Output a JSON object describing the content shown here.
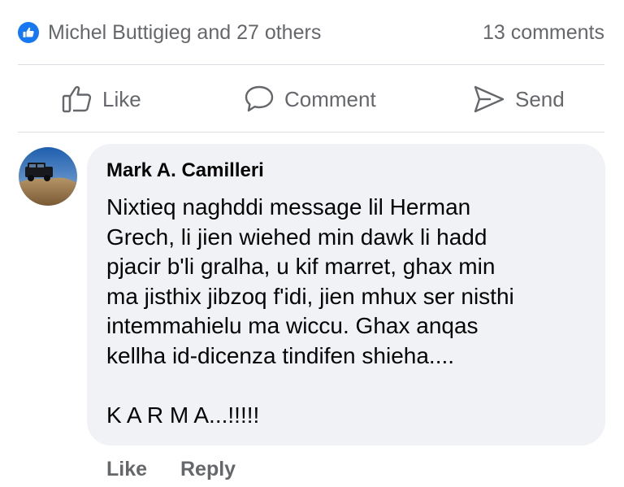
{
  "post_summary": {
    "reactors": "Michel Buttigieg and 27 others",
    "comment_count": "13 comments",
    "reaction_icon": "thumbs-up-icon",
    "reaction_color": "#1877f2"
  },
  "actions": [
    {
      "label": "Like",
      "icon": "thumbs-up-outline-icon"
    },
    {
      "label": "Comment",
      "icon": "speech-bubble-icon"
    },
    {
      "label": "Send",
      "icon": "paper-plane-icon"
    }
  ],
  "comment": {
    "author": "Mark A. Camilleri",
    "text": "Nixtieq naghddi message lil Herman\nGrech, li jien wiehed min dawk li hadd\npjacir b'li gralha, u kif marret, ghax min\nma jisthix jibzoq f'idi, jien mhux ser nisthi\nintemmahielu ma wiccu. Ghax anqas\nkellha id-dicenza tindifen shieha....\n\nK A R M A...!!!!!",
    "like_label": "Like",
    "reply_label": "Reply",
    "bubble_color": "#f0f2f5"
  }
}
